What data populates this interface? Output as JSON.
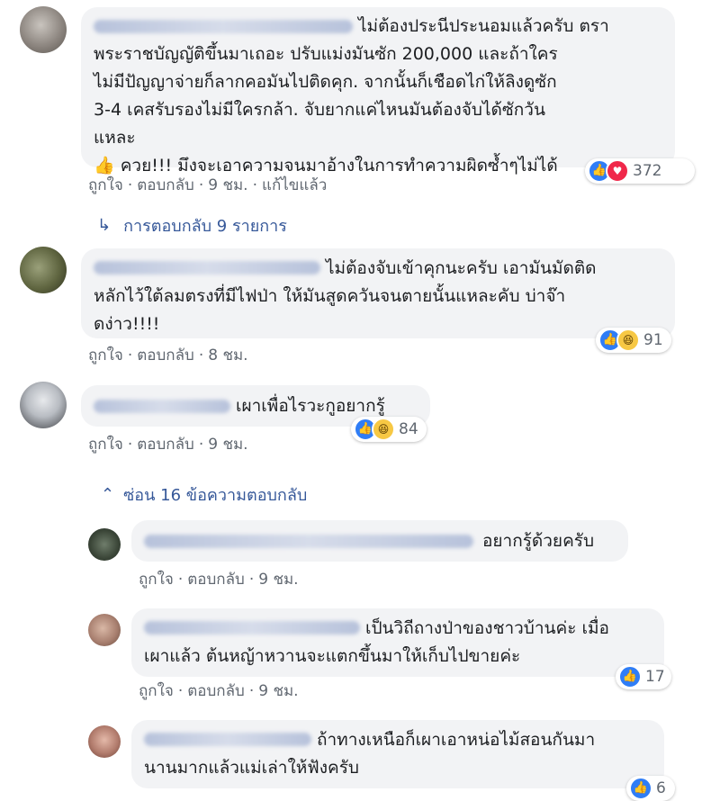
{
  "comments": [
    {
      "text": "ไม่ต้องประนีประนอมแล้วครับ ตรา\nพระราชบัญญัติขึ้นมาเถอะ ปรับแม่งมันซัก 200,000 และถ้าใคร\nไม่มีปัญญาจ่ายก็ลากคอมันไปติดคุก. จากนั้นก็เชือดไก่ให้ลิงดูซัก\n3-4 เคสรับรองไม่มีใครกล้า. จับยากแค่ไหนมันต้องจับได้ซักวัน\nแหละ\n👍 ควย!!! มึงจะเอาความจนมาอ้างในการทำความผิดซ้ำๆไม่ได้",
      "like": "ถูกใจ",
      "reply": "ตอบกลับ",
      "time": "9 ชม.",
      "edited": "แก้ไขแล้ว",
      "reaction_count": "372"
    },
    {
      "text": "ไม่ต้องจับเข้าคุกนะครับ เอามันมัดติด\nหลักไว้ใต้ลมตรงที่มีไฟป่า ให้มันสูดควันจนตายนั้นแหละคับ บ่าจ๊า\nดง่าว!!!!",
      "like": "ถูกใจ",
      "reply": "ตอบกลับ",
      "time": "8 ชม.",
      "reaction_count": "91"
    },
    {
      "text": "เผาเพื่อไรวะกูอยากรู้",
      "like": "ถูกใจ",
      "reply": "ตอบกลับ",
      "time": "9 ชม.",
      "reaction_count": "84"
    }
  ],
  "replies_link": "การตอบกลับ 9 รายการ",
  "hide_link": "ซ่อน 16 ข้อความตอบกลับ",
  "replies": [
    {
      "text": "อยากรู้ด้วยครับ",
      "like": "ถูกใจ",
      "reply": "ตอบกลับ",
      "time": "9 ชม."
    },
    {
      "text": "เป็นวิถีถางป่าของชาวบ้านค่ะ เมื่อ\nเผาแล้ว ต้นหญ้าหวานจะแตกขึ้นมาให้เก็บไปขายค่ะ",
      "like": "ถูกใจ",
      "reply": "ตอบกลับ",
      "time": "9 ชม.",
      "reaction_count": "17"
    },
    {
      "text": "ถ้าทางเหนือก็เผาเอาหน่อไม้สอนกันมา\nนานมากแล้วแม่เล่าให้ฟังครับ",
      "reaction_count": "6"
    }
  ],
  "icons": {
    "like": "thumbs-up-icon",
    "haha": "laughing-face-icon",
    "love": "heart-icon",
    "reply_arrow": "reply-arrow-icon",
    "chevron": "chevron-up-icon"
  },
  "colors": {
    "bubble": "#f2f3f5",
    "link": "#365899",
    "meta": "#606770",
    "like_blue": "#2f7df6",
    "love_red": "#f0284a",
    "haha_yellow": "#f7c844"
  }
}
